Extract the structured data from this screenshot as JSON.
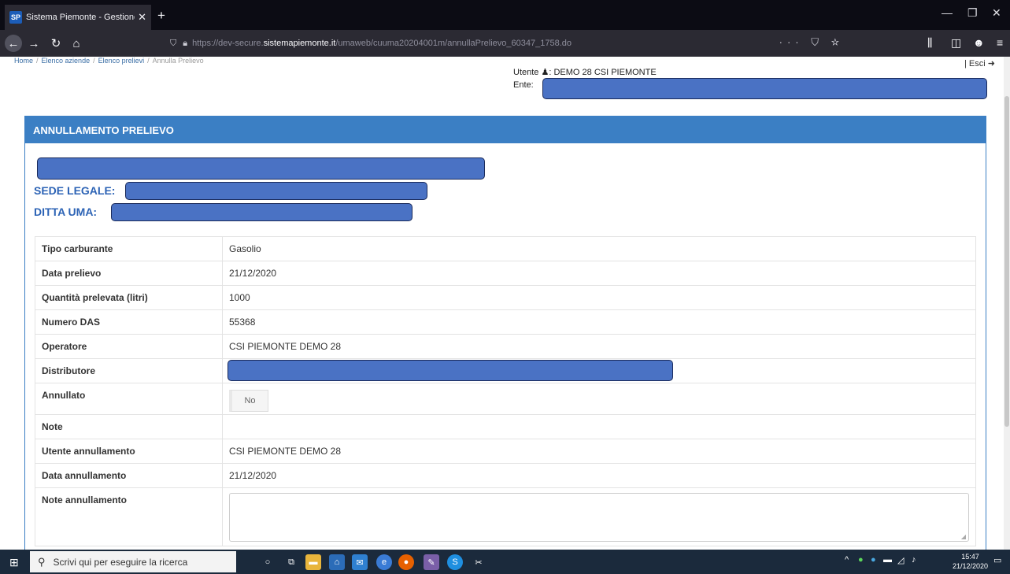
{
  "browser": {
    "tab_icon": "SP",
    "tab_title": "Sistema Piemonte - Gestione a",
    "url_prefix": "https://dev-secure.",
    "url_host": "sistemapiemonte.it",
    "url_path": "/umaweb/cuuma20204001m/annullaPrelievo_60347_1758.do",
    "url_extra_icons": "··· ⛉ ☆"
  },
  "breadcrumb": {
    "home": "Home",
    "aziende": "Elenco aziende",
    "prelievi": "Elenco prelievi",
    "current": "Annulla Prelievo"
  },
  "header": {
    "user_label": "Utente",
    "user_name": "DEMO 28 CSI PIEMONTE",
    "ente_label": "Ente:",
    "logout": "| Esci"
  },
  "panel": {
    "title": "ANNULLAMENTO PRELIEVO",
    "sede_label": "SEDE LEGALE:",
    "ditta_label": "DITTA UMA:"
  },
  "details": {
    "tipo_carburante": {
      "label": "Tipo carburante",
      "value": "Gasolio"
    },
    "data_prelievo": {
      "label": "Data prelievo",
      "value": "21/12/2020"
    },
    "quantita": {
      "label": "Quantità prelevata (litri)",
      "value": "1000"
    },
    "numero_das": {
      "label": "Numero DAS",
      "value": "55368"
    },
    "operatore": {
      "label": "Operatore",
      "value": "CSI PIEMONTE DEMO 28"
    },
    "distributore": {
      "label": "Distributore",
      "value": ""
    },
    "annullato": {
      "label": "Annullato",
      "value": "No"
    },
    "note": {
      "label": "Note",
      "value": ""
    },
    "utente_annullamento": {
      "label": "Utente annullamento",
      "value": "CSI PIEMONTE DEMO 28"
    },
    "data_annullamento": {
      "label": "Data annullamento",
      "value": "21/12/2020"
    },
    "note_annullamento": {
      "label": "Note annullamento",
      "value": ""
    }
  },
  "taskbar": {
    "search_placeholder": "Scrivi qui per eseguire la ricerca",
    "time": "15:47",
    "date": "21/12/2020"
  }
}
